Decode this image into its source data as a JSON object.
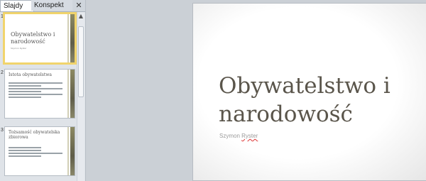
{
  "pane": {
    "tabs": [
      "Slajdy",
      "Konspekt"
    ],
    "close_glyph": "✕",
    "slides": [
      {
        "num": "1",
        "title": "Obywatelstwo i narodowość",
        "sub": "Szymon Ryster"
      },
      {
        "num": "2",
        "title": "Istota obywatelstwa"
      },
      {
        "num": "3",
        "title": "Tożsamość obywatelska zbiorowa"
      }
    ]
  },
  "slide": {
    "title_line1": "Obywatelstwo i",
    "title_line2": "narodowość",
    "author_first": "Szymon",
    "author_last": "Ryster"
  },
  "colors": {
    "thumb_selected": "#f1d46c",
    "title_text": "#5a554b"
  }
}
